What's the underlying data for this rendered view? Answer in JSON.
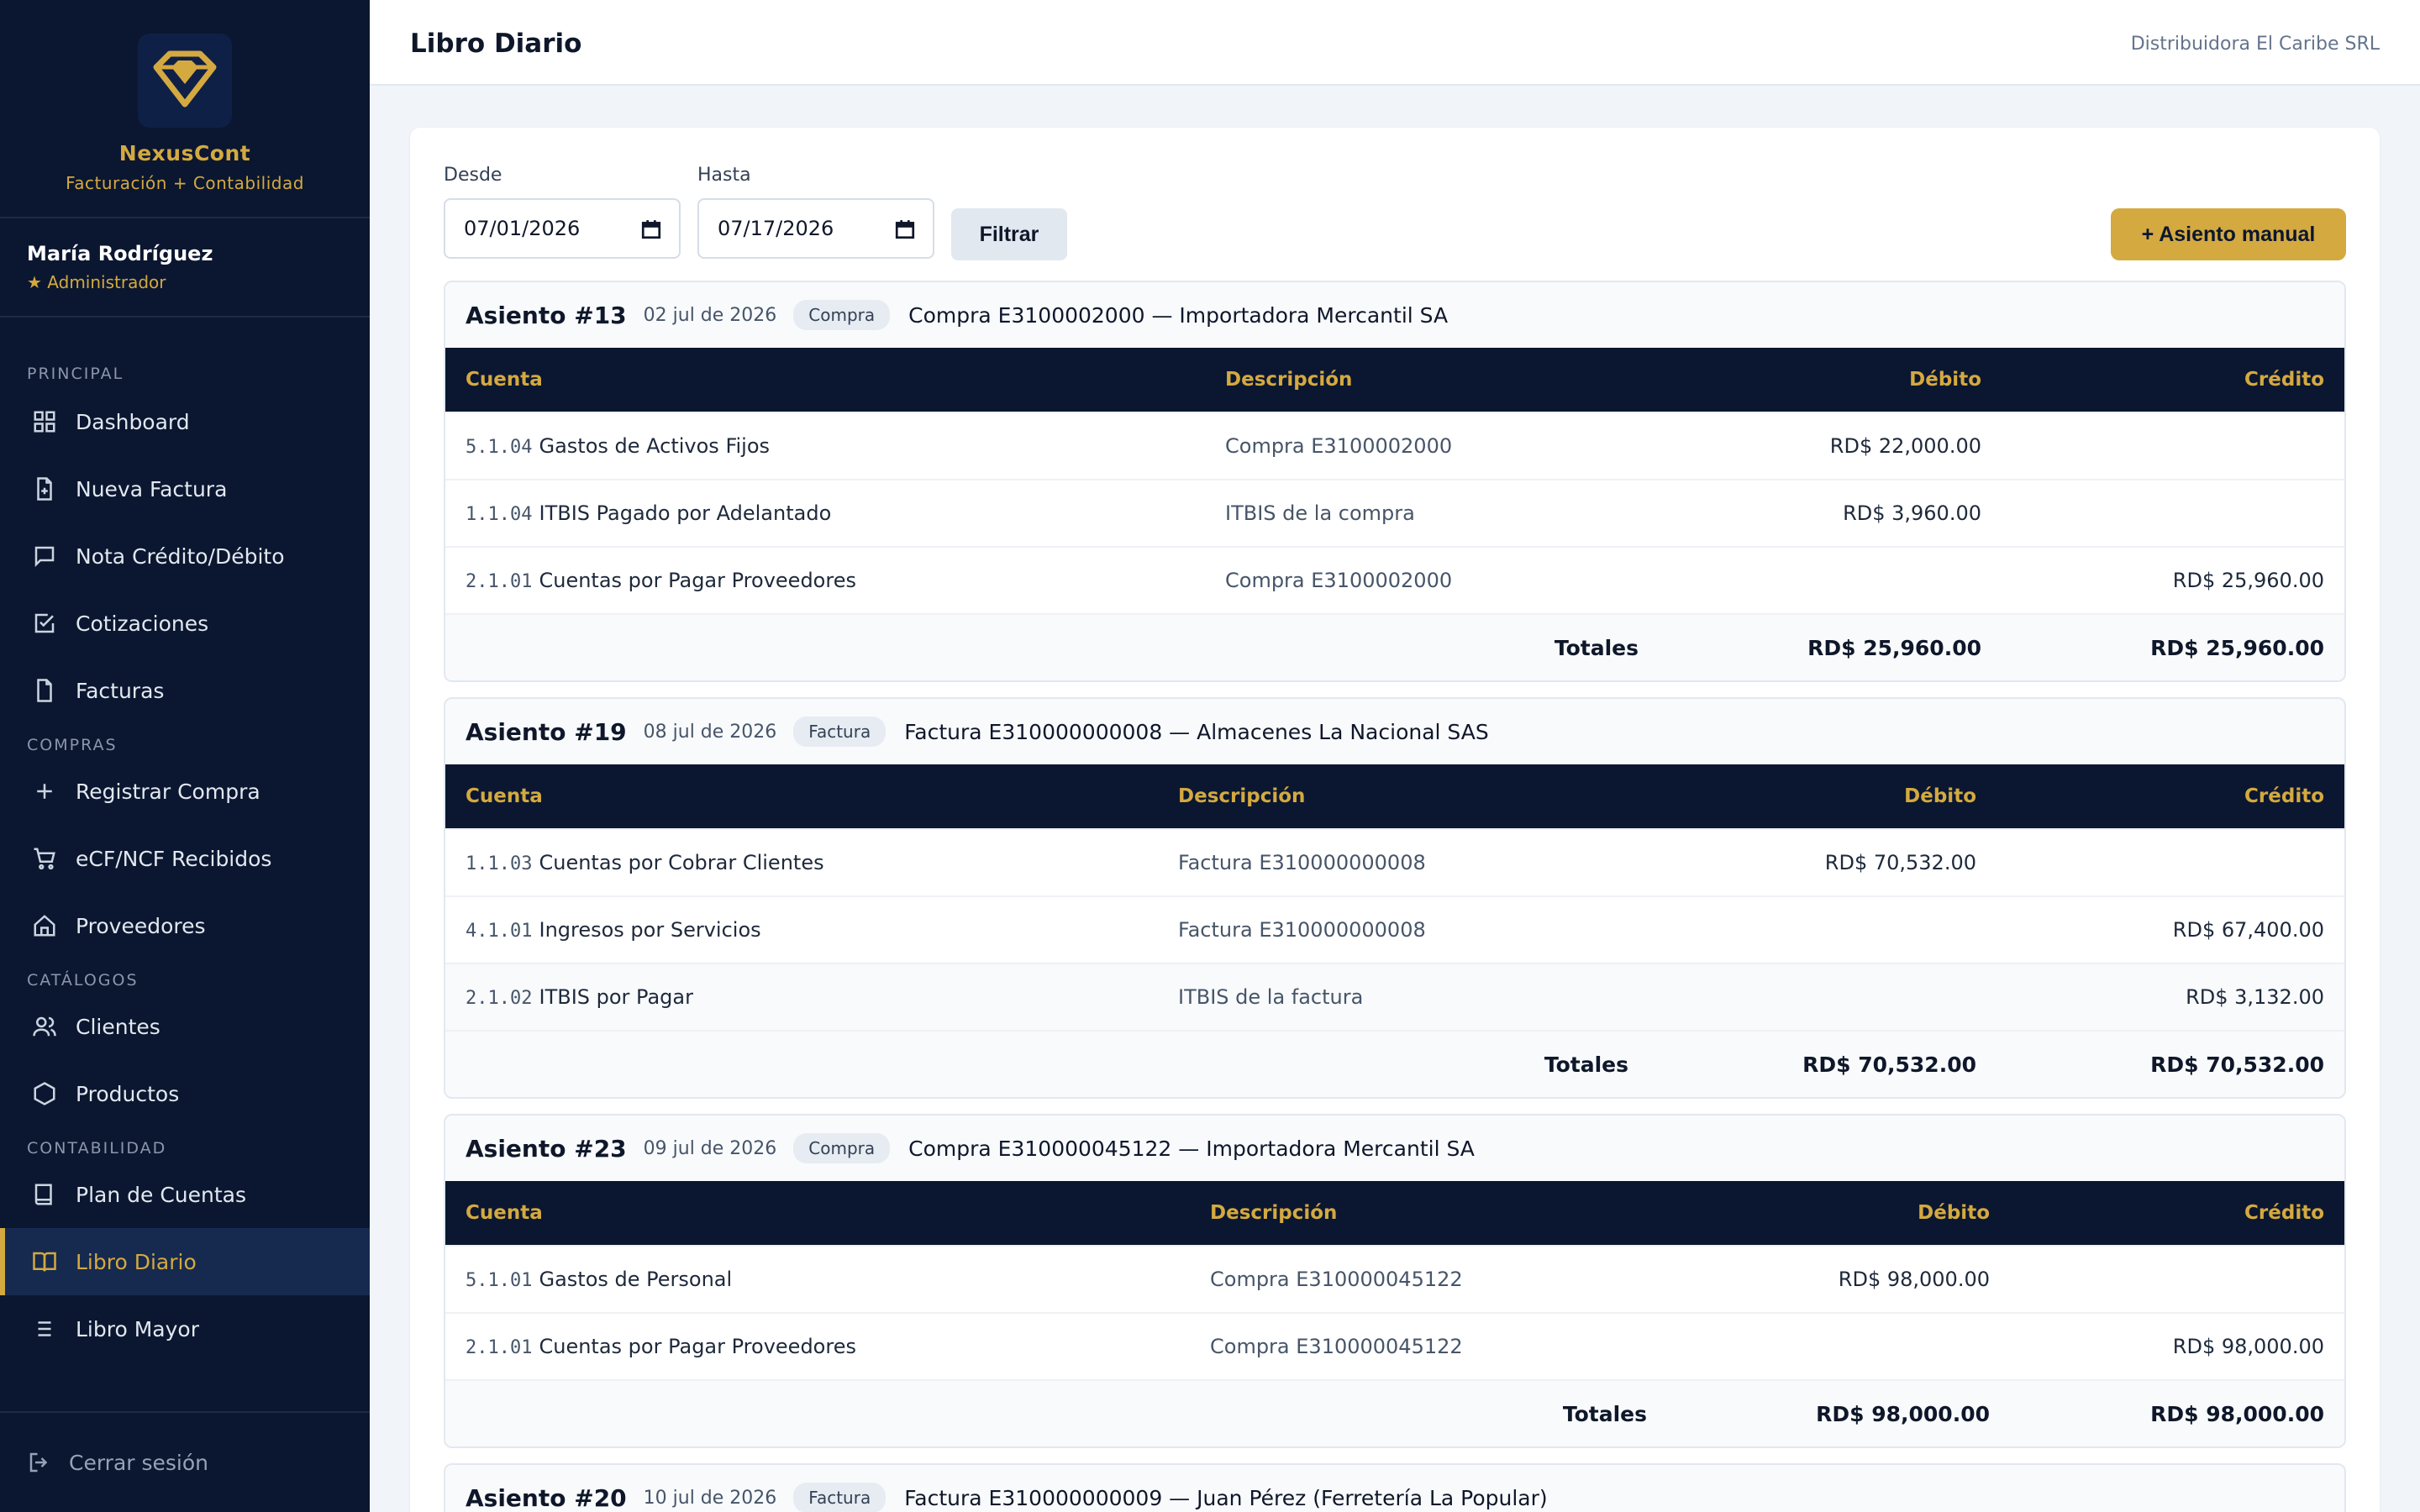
{
  "sidebar": {
    "brand_name": "NexusCont",
    "brand_sub": "Facturación + Contabilidad",
    "user_name": "María Rodríguez",
    "user_role": "★ Administrador",
    "sections": {
      "principal": "PRINCIPAL",
      "compras": "COMPRAS",
      "catalogos": "CATÁLOGOS",
      "contabilidad": "CONTABILIDAD"
    },
    "items": {
      "dashboard": "Dashboard",
      "nueva_factura": "Nueva Factura",
      "nota": "Nota Crédito/Débito",
      "cotizaciones": "Cotizaciones",
      "facturas": "Facturas",
      "registrar_compra": "Registrar Compra",
      "ecf": "eCF/NCF Recibidos",
      "proveedores": "Proveedores",
      "clientes": "Clientes",
      "productos": "Productos",
      "plan": "Plan de Cuentas",
      "libro_diario": "Libro Diario",
      "libro_mayor": "Libro Mayor"
    },
    "logout": "Cerrar sesión"
  },
  "header": {
    "title": "Libro Diario",
    "company": "Distribuidora El Caribe SRL"
  },
  "filters": {
    "from_label": "Desde",
    "from_value": "07/01/2026",
    "to_label": "Hasta",
    "to_value": "07/17/2026",
    "filter_button": "Filtrar",
    "manual_button": "+ Asiento manual"
  },
  "table_headers": {
    "cuenta": "Cuenta",
    "descripcion": "Descripción",
    "debito": "Débito",
    "credito": "Crédito",
    "totales": "Totales"
  },
  "entries": [
    {
      "number": "Asiento #13",
      "date": "02 jul de 2026",
      "type": "Compra",
      "description": "Compra E3100002000 — Importadora Mercantil SA",
      "lines": [
        {
          "code": "5.1.04",
          "account": "Gastos de Activos Fijos",
          "desc": "Compra E3100002000",
          "debit": "RD$ 22,000.00",
          "credit": ""
        },
        {
          "code": "1.1.04",
          "account": "ITBIS Pagado por Adelantado",
          "desc": "ITBIS de la compra",
          "debit": "RD$ 3,960.00",
          "credit": ""
        },
        {
          "code": "2.1.01",
          "account": "Cuentas por Pagar Proveedores",
          "desc": "Compra E3100002000",
          "debit": "",
          "credit": "RD$ 25,960.00"
        }
      ],
      "total_debit": "RD$ 25,960.00",
      "total_credit": "RD$ 25,960.00"
    },
    {
      "number": "Asiento #19",
      "date": "08 jul de 2026",
      "type": "Factura",
      "description": "Factura E310000000008 — Almacenes La Nacional SAS",
      "lines": [
        {
          "code": "1.1.03",
          "account": "Cuentas por Cobrar Clientes",
          "desc": "Factura E310000000008",
          "debit": "RD$ 70,532.00",
          "credit": ""
        },
        {
          "code": "4.1.01",
          "account": "Ingresos por Servicios",
          "desc": "Factura E310000000008",
          "debit": "",
          "credit": "RD$ 67,400.00"
        },
        {
          "code": "2.1.02",
          "account": "ITBIS por Pagar",
          "desc": "ITBIS de la factura",
          "debit": "",
          "credit": "RD$ 3,132.00"
        }
      ],
      "total_debit": "RD$ 70,532.00",
      "total_credit": "RD$ 70,532.00"
    },
    {
      "number": "Asiento #23",
      "date": "09 jul de 2026",
      "type": "Compra",
      "description": "Compra E310000045122 — Importadora Mercantil SA",
      "lines": [
        {
          "code": "5.1.01",
          "account": "Gastos de Personal",
          "desc": "Compra E310000045122",
          "debit": "RD$ 98,000.00",
          "credit": ""
        },
        {
          "code": "2.1.01",
          "account": "Cuentas por Pagar Proveedores",
          "desc": "Compra E310000045122",
          "debit": "",
          "credit": "RD$ 98,000.00"
        }
      ],
      "total_debit": "RD$ 98,000.00",
      "total_credit": "RD$ 98,000.00"
    },
    {
      "number": "Asiento #20",
      "date": "10 jul de 2026",
      "type": "Factura",
      "description": "Factura E310000000009 — Juan Pérez (Ferretería La Popular)"
    }
  ]
}
